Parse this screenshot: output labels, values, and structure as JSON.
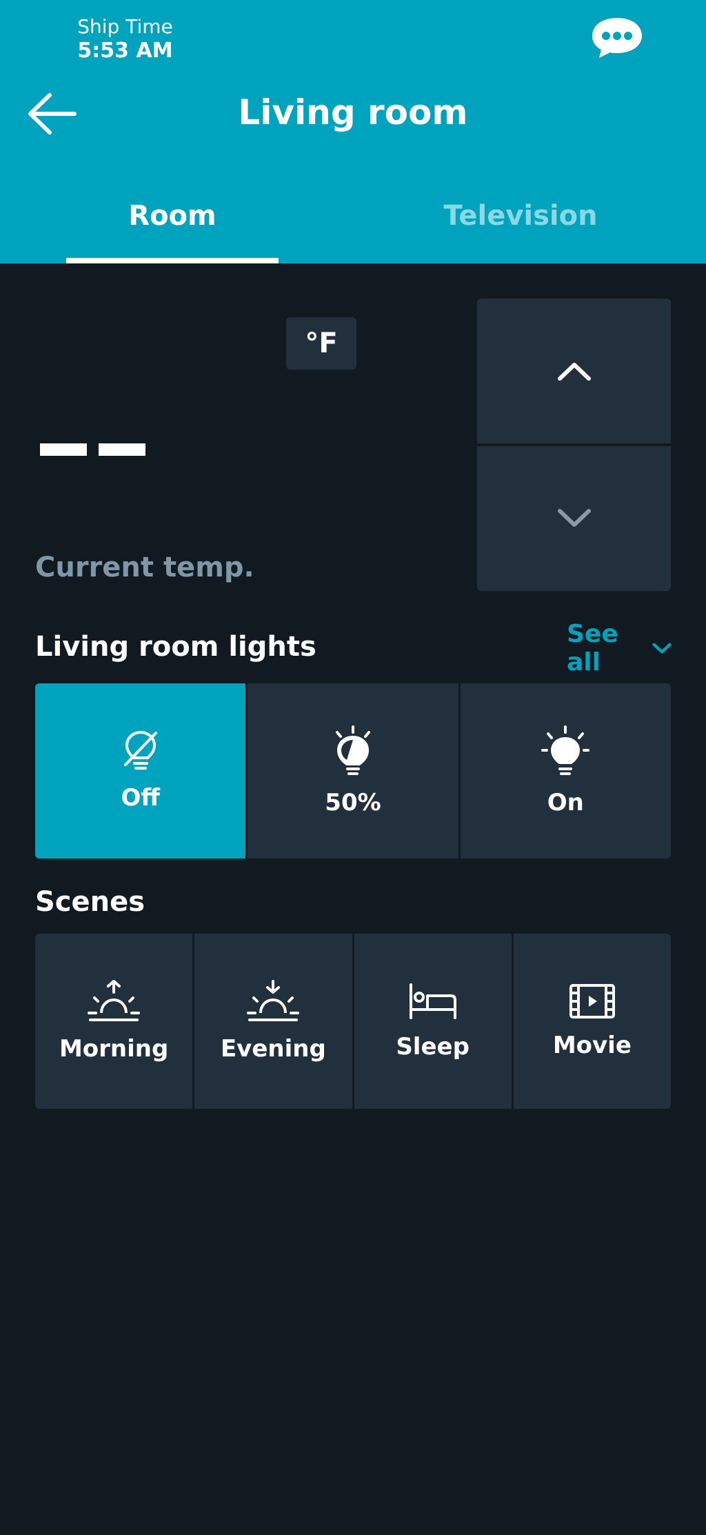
{
  "status": {
    "label": "Ship Time",
    "time": "5:53 AM"
  },
  "header": {
    "title": "Living room",
    "back_icon": "arrow-left-icon",
    "chat_icon": "chat-bubble-icon"
  },
  "tabs": [
    {
      "label": "Room",
      "selected": true
    },
    {
      "label": "Television",
      "selected": false
    }
  ],
  "thermostat": {
    "unit": "°F",
    "current_temp_label": "Current temp.",
    "up_icon": "chevron-up-icon",
    "down_icon": "chevron-down-icon"
  },
  "lights": {
    "title": "Living room lights",
    "see_all": "See all",
    "options": [
      {
        "label": "Off",
        "icon": "light-off-icon",
        "selected": true
      },
      {
        "label": "50%",
        "icon": "light-half-icon",
        "selected": false
      },
      {
        "label": "On",
        "icon": "light-on-icon",
        "selected": false
      }
    ]
  },
  "scenes": {
    "title": "Scenes",
    "items": [
      {
        "label": "Morning",
        "icon": "sunrise-icon"
      },
      {
        "label": "Evening",
        "icon": "sunset-icon"
      },
      {
        "label": "Sleep",
        "icon": "bed-icon"
      },
      {
        "label": "Movie",
        "icon": "film-icon"
      }
    ]
  },
  "colors": {
    "accent": "#00a3bd",
    "background": "#111921",
    "tile": "#222f3c",
    "muted_text": "#7f97a8"
  }
}
